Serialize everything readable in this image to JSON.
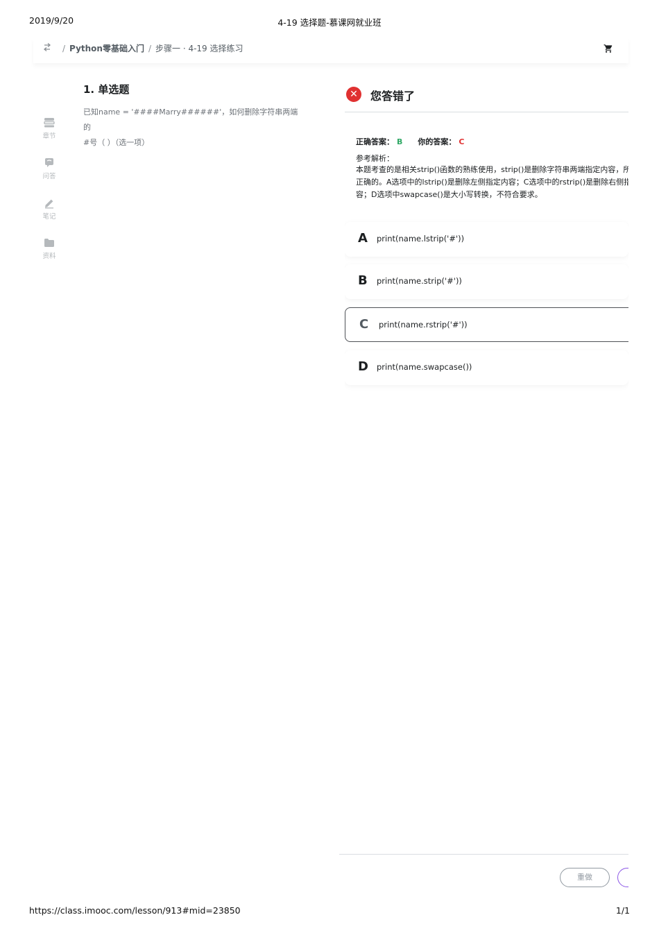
{
  "print_header": {
    "date": "2019/9/20",
    "title": "4-19 选择题-慕课网就业班"
  },
  "print_footer": {
    "url": "https://class.imooc.com/lesson/913#mid=23850",
    "page": "1/1"
  },
  "breadcrumb": {
    "back_icon": "swap-back-icon",
    "separator": "/",
    "course": "Python零基础入门",
    "current": "步骤一 · 4-19 选择练习"
  },
  "cart_icon": "shopping-cart-icon",
  "sidebar": {
    "items": [
      {
        "label": "章节",
        "icon": "chapters-icon"
      },
      {
        "label": "问答",
        "icon": "qa-icon"
      },
      {
        "label": "笔记",
        "icon": "pencil-icon"
      },
      {
        "label": "资料",
        "icon": "folder-icon"
      }
    ]
  },
  "question": {
    "title": "1. 单选题",
    "text_line1": "已知name = '####Marry######'，如何删除字符串两端的",
    "text_line2": "#号（ ）（选一项）"
  },
  "result": {
    "icon": "close-circle-icon",
    "title": "您答错了",
    "correct_label": "正确答案：",
    "correct_value": "B",
    "yours_label": "你的答案：",
    "yours_value": "C",
    "analysis_label": "参考解析：",
    "analysis_line1": "本题考查的是相关strip()函数的熟练使用，strip()是删除字符串两端指定内容，所",
    "analysis_line2": "正确的。A选项中的lstrip()是删除左侧指定内容；C选项中的rstrip()是删除右侧指",
    "analysis_line3": "容；D选项中swapcase()是大小写转换，不符合要求。"
  },
  "options": [
    {
      "letter": "A",
      "text": "print(name.lstrip('#'))"
    },
    {
      "letter": "B",
      "text": "print(name.strip('#'))"
    },
    {
      "letter": "C",
      "text": "print(name.rstrip('#'))",
      "selected": true
    },
    {
      "letter": "D",
      "text": "print(name.swapcase())"
    }
  ],
  "actions": {
    "redo": "重做"
  },
  "colors": {
    "correct": "#2fa865",
    "wrong": "#e03131",
    "accent": "#8b56e6"
  }
}
